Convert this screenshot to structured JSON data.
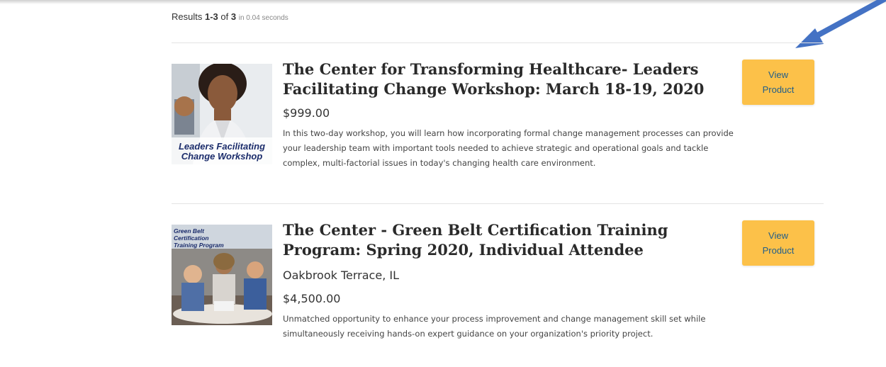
{
  "results_summary": {
    "prefix": "Results",
    "range": "1-3",
    "of_word": "of",
    "total": "3",
    "time": "in 0.04 seconds"
  },
  "products": [
    {
      "title": "The Center for Transforming Healthcare- Leaders Facilitating Change Workshop: March 18-19, 2020",
      "price": "$999.00",
      "description": "In this two-day workshop, you will learn how incorporating formal change management processes can provide your leadership team with important tools needed to achieve strategic and operational goals and tackle complex, multi-factorial issues in today's changing health care environment.",
      "thumbnail_text": "Leaders Facilitating Change Workshop",
      "button_label_line1": "View",
      "button_label_line2": "Product"
    },
    {
      "title": "The Center - Green Belt Certification Training Program: Spring 2020, Individual Attendee",
      "location": "Oakbrook Terrace, IL",
      "price": "$4,500.00",
      "description": "Unmatched opportunity to enhance your process improvement and change management skill set while simultaneously receiving hands-on expert guidance on your organization's priority project.",
      "thumbnail_text": "Green Belt Certification Training Program",
      "button_label_line1": "View",
      "button_label_line2": "Product"
    }
  ],
  "colors": {
    "button_bg": "#fcc149",
    "button_text": "#215e8a",
    "arrow": "#4472c4"
  },
  "annotation": {
    "icon": "arrow-pointer-icon"
  }
}
